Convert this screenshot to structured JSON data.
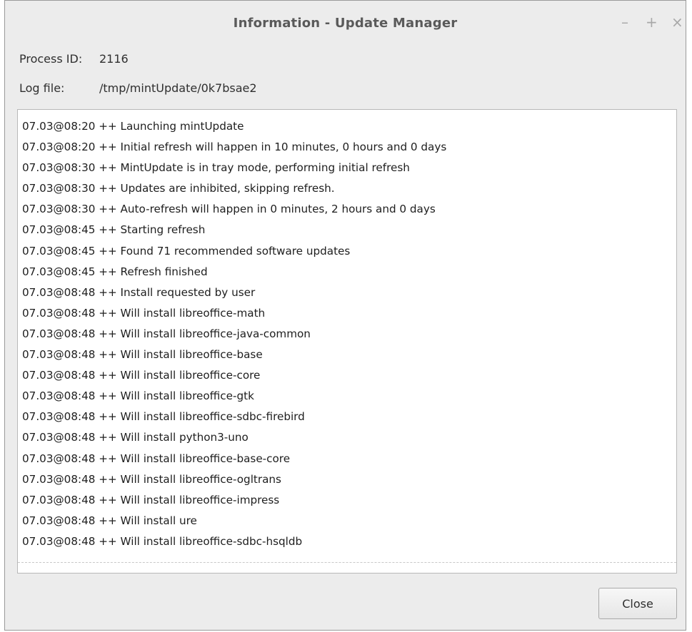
{
  "window": {
    "title": "Information - Update Manager",
    "controls": {
      "minimize": "–",
      "maximize": "+",
      "close": "×"
    }
  },
  "info": {
    "process_label": "Process ID:",
    "process_value": "2116",
    "log_label": "Log file:",
    "log_value": "/tmp/mintUpdate/0k7bsae2"
  },
  "log": {
    "lines": [
      "07.03@08:20 ++ Launching mintUpdate",
      "07.03@08:20 ++ Initial refresh will happen in 10 minutes, 0 hours and 0 days",
      "07.03@08:30 ++ MintUpdate is in tray mode, performing initial refresh",
      "07.03@08:30 ++ Updates are inhibited, skipping refresh.",
      "07.03@08:30 ++ Auto-refresh will happen in 0 minutes, 2 hours and 0 days",
      "07.03@08:45 ++ Starting refresh",
      "07.03@08:45 ++ Found 71 recommended software updates",
      "07.03@08:45 ++ Refresh finished",
      "07.03@08:48 ++ Install requested by user",
      "07.03@08:48 ++ Will install libreoffice-math",
      "07.03@08:48 ++ Will install libreoffice-java-common",
      "07.03@08:48 ++ Will install libreoffice-base",
      "07.03@08:48 ++ Will install libreoffice-core",
      "07.03@08:48 ++ Will install libreoffice-gtk",
      "07.03@08:48 ++ Will install libreoffice-sdbc-firebird",
      "07.03@08:48 ++ Will install python3-uno",
      "07.03@08:48 ++ Will install libreoffice-base-core",
      "07.03@08:48 ++ Will install libreoffice-ogltrans",
      "07.03@08:48 ++ Will install libreoffice-impress",
      "07.03@08:48 ++ Will install ure",
      "07.03@08:48 ++ Will install libreoffice-sdbc-hsqldb"
    ]
  },
  "footer": {
    "close_label": "Close"
  }
}
